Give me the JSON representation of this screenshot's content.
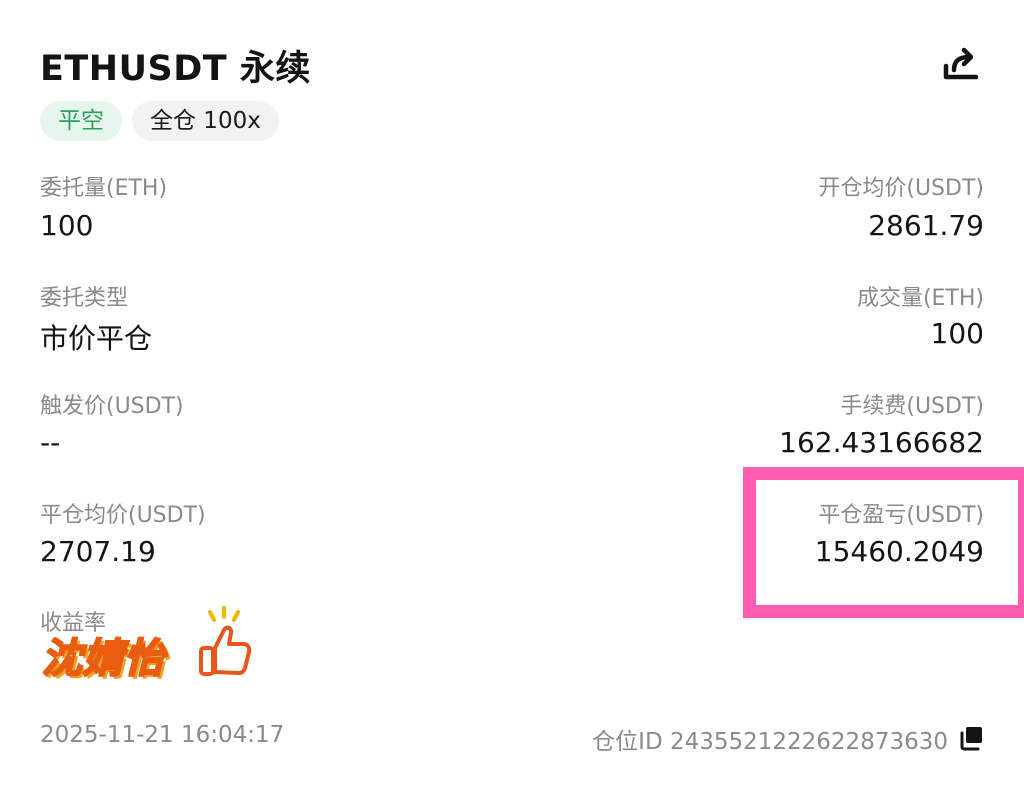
{
  "header": {
    "title": "ETHUSDT 永续",
    "share_icon": "share-icon"
  },
  "tags": {
    "side": "平空",
    "margin": "全仓 100x"
  },
  "fields": {
    "order_qty_label": "委托量(ETH)",
    "order_qty_value": "100",
    "open_avg_label": "开仓均价(USDT)",
    "open_avg_value": "2861.79",
    "order_type_label": "委托类型",
    "order_type_value": "市价平仓",
    "filled_qty_label": "成交量(ETH)",
    "filled_qty_value": "100",
    "trigger_price_label": "触发价(USDT)",
    "trigger_price_value": "--",
    "fee_label": "手续费(USDT)",
    "fee_value": "162.43166682",
    "close_avg_label": "平仓均价(USDT)",
    "close_avg_value": "2707.19",
    "close_pnl_label": "平仓盈亏(USDT)",
    "close_pnl_value": "15460.2049",
    "roi_label": "收益率"
  },
  "sticker": {
    "text": "沈婧怡",
    "icon": "thumbs-up-icon"
  },
  "footer": {
    "time": "2025-11-21 16:04:17",
    "position_id": "仓位ID 2435521222622873630",
    "copy_icon": "copy-icon"
  },
  "colors": {
    "highlight": "#ff5bb1",
    "tag_green_text": "#27a35a",
    "tag_green_bg": "#e6f6ec",
    "label_gray": "#8a8a8a"
  }
}
